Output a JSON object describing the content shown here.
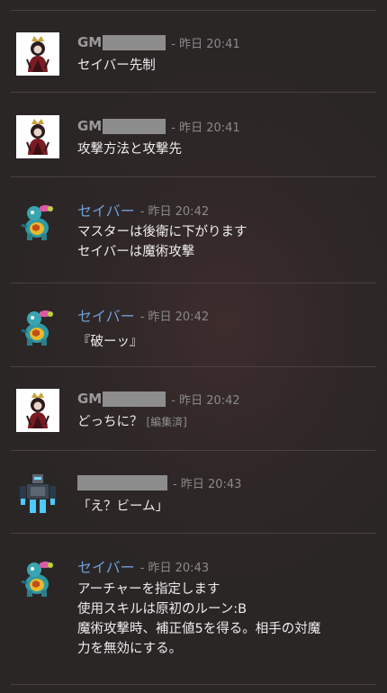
{
  "messages": [
    {
      "kind": "gm",
      "name": "GM",
      "time": "- 昨日 20:41",
      "lines": [
        "セイバー先制"
      ]
    },
    {
      "kind": "gm",
      "name": "GM",
      "time": "- 昨日 20:41",
      "lines": [
        "攻撃方法と攻撃先"
      ]
    },
    {
      "kind": "saber",
      "name": "セイバー",
      "time": "- 昨日 20:42",
      "lines": [
        "マスターは後衛に下がります",
        "セイバーは魔術攻撃"
      ]
    },
    {
      "kind": "saber",
      "name": "セイバー",
      "time": "- 昨日 20:42",
      "lines": [
        "『破ーッ』"
      ]
    },
    {
      "kind": "gm",
      "name": "GM",
      "time": "- 昨日 20:42",
      "lines": [
        "どっちに？"
      ],
      "edited": "[編集済]"
    },
    {
      "kind": "robot",
      "name": "",
      "time": "- 昨日 20:43",
      "lines": [
        "「え？ビーム」"
      ]
    },
    {
      "kind": "saber",
      "name": "セイバー",
      "time": "- 昨日 20:43",
      "lines": [
        "アーチャーを指定します",
        "使用スキルは原初のルーン:B",
        "魔術攻撃時、補正値5を得る。相手の対魔",
        "力を無効にする。"
      ]
    }
  ],
  "icons": {
    "gm": "gm-character-avatar",
    "saber": "turtle-creature-avatar",
    "robot": "robot-avatar"
  }
}
